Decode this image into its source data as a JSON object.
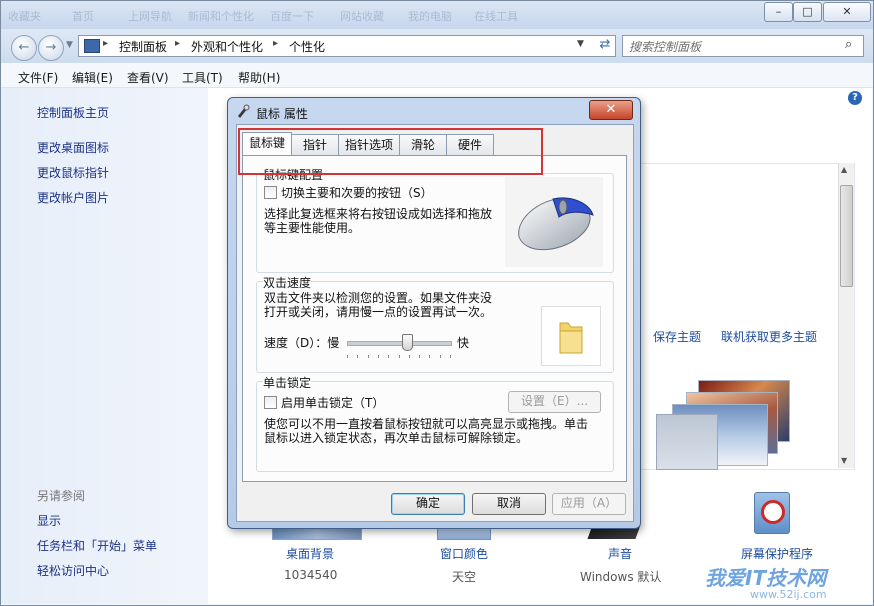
{
  "window": {
    "address": [
      "控制面板",
      "外观和个性化",
      "个性化"
    ],
    "search_placeholder": "搜索控制面板",
    "bg_tabs": [
      "收藏夹",
      "首页",
      "上网导航",
      "新闻和个性化",
      "百度一下",
      "网站收藏",
      "我的电脑",
      "在线工具"
    ]
  },
  "menubar": [
    "文件(F)",
    "编辑(E)",
    "查看(V)",
    "工具(T)",
    "帮助(H)"
  ],
  "sidebar": {
    "home": "控制面板主页",
    "links": [
      "更改桌面图标",
      "更改鼠标指针",
      "更改帐户图片"
    ],
    "see_also_title": "另请参阅",
    "see_also": [
      "显示",
      "任务栏和「开始」菜单",
      "轻松访问中心"
    ]
  },
  "themes": {
    "save_theme": "保存主题",
    "get_more": "联机获取更多主题"
  },
  "bottom": {
    "items": [
      {
        "label": "桌面背景",
        "sub": "1034540"
      },
      {
        "label": "窗口颜色",
        "sub": "天空"
      },
      {
        "label": "声音",
        "sub": "Windows 默认"
      },
      {
        "label": "屏幕保护程序",
        "sub": ""
      }
    ]
  },
  "dialog": {
    "title": "鼠标 属性",
    "tabs": [
      "鼠标键",
      "指针",
      "指针选项",
      "滑轮",
      "硬件"
    ],
    "config_group": "鼠标键配置",
    "swap_label": "切换主要和次要的按钮（S）",
    "swap_desc1": "选择此复选框来将右按钮设成如选择和拖放",
    "swap_desc2": "等主要性能使用。",
    "dbl_group": "双击速度",
    "dbl_desc1": "双击文件夹以检测您的设置。如果文件夹没",
    "dbl_desc2": "打开或关闭，请用慢一点的设置再试一次。",
    "speed_label": "速度（D）：慢",
    "fast_label": "快",
    "speed_value": 0.58,
    "clicklock_group": "单击锁定",
    "clicklock_label": "启用单击锁定（T）",
    "settings_button": "设置（E）...",
    "clicklock_desc1": "使您可以不用一直按着鼠标按钮就可以高亮显示或拖拽。单击",
    "clicklock_desc2": "鼠标以进入锁定状态，再次单击鼠标可解除锁定。",
    "ok": "确定",
    "cancel": "取消",
    "apply": "应用（A）"
  },
  "watermark": {
    "title": "我爱IT技术网",
    "url": "www.52ij.com"
  }
}
